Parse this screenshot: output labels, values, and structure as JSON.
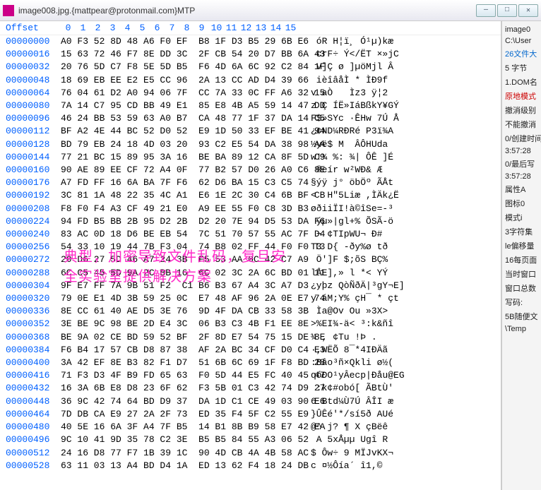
{
  "title": "image008.jpg.{mattpear@protonmail.com}MTP",
  "winbtns": {
    "min": "—",
    "max": "□",
    "close": "✕"
  },
  "header": {
    "offset": "Offset",
    "cols": [
      "0",
      "1",
      "2",
      "3",
      "4",
      "5",
      "6",
      "7",
      "8",
      "9",
      "10",
      "11",
      "12",
      "13",
      "14",
      "15"
    ]
  },
  "rows": [
    {
      "o": "00000000",
      "h": "A0 F3 52 8D 48 A6 F0 EF  B8 1F D3 B5 29 6B E6",
      "a": " óR H¦ï¸ Ó¹µ)kæ"
    },
    {
      "o": "00000016",
      "h": "15 63 72 46 F7 8E DD 3C  2F CB 54 20 D7 BB 6A 43",
      "a": " crF÷ Ý</ËT ×»jC"
    },
    {
      "o": "00000032",
      "h": "20 76 5D C7 F8 5E 5D B5  F6 4D 6A 6C 92 C2 84 1F",
      "a": " v]Ç ø ]µöMjl Â "
    },
    {
      "o": "00000048",
      "h": "18 69 EB EE E2 E5 CC 96  2A 13 CC AD D4 39 66",
      "a": " ièîâåÌ * ÌÐ9f"
    },
    {
      "o": "00000064",
      "h": "76 04 61 D2 A0 94 06 7F  CC 7A 33 0C FF A6 32 15",
      "a": "v aÒ   Ìz3 ÿ¦2 "
    },
    {
      "o": "00000080",
      "h": "7A 14 C7 95 CD BB 49 E1  85 E8 4B A5 59 14 47 DD",
      "a": "z Ç ÍË»IáBßkY¥GÝ"
    },
    {
      "o": "00000096",
      "h": "46 24 BB 53 59 63 A0 B7  CA 48 77 1F 37 DA 14 C5",
      "a": "F$»SYc ·ÊHw 7Ú Å"
    },
    {
      "o": "00000112",
      "h": "BF A2 4E 44 BC 52 D0 52  E9 1D 50 33 EF BE 41 94",
      "a": "¿¢ND¼RÐRé P3ï¾A "
    },
    {
      "o": "00000128",
      "h": "BD 79 EB 24 18 4D 03 20  93 C2 E5 54 DA 38 98 AA",
      "a": "½yë$ M  ÂÔHUda "
    },
    {
      "o": "00000144",
      "h": "77 21 BC 15 89 95 3A 16  BE BA 89 12 CA 8F 5D C9",
      "a": "w!¼ %: ¾| ÔÊ ]É"
    },
    {
      "o": "00000160",
      "h": "90 AE 89 EE CF 72 A4 0F  77 B2 57 D0 26 A0 C6 8E",
      "a": " ®eír w²WÐ& Æ "
    },
    {
      "o": "00000176",
      "h": "A7 FD FF 16 6A BA 7F F6  62 D6 BA 15 C3 C5 74",
      "a": "§ýÿ j° öbÖº ÃÅt"
    },
    {
      "o": "00000192",
      "h": "3C 81 1A 48 22 35 4C A1  E6 1E 2C 30 C4 6B BF CB",
      "a": "<  H\"5Liæ ,ÌÄk¿Ë"
    },
    {
      "o": "00000208",
      "h": "F8 F0 F4 A3 CF 49 21 E0  A9 EE 55 F0 C8 3D B3",
      "a": "øðiiÏI!à©îSe=-³"
    },
    {
      "o": "00000224",
      "h": "94 FD B5 BB 2B 95 D2 2B  D2 20 7E 94 D5 53 DA F6",
      "a": " ýµ»|gl+% ÕSÃ-ö"
    },
    {
      "o": "00000240",
      "h": "83 AC 0D 18 D6 BE EB 54  7C 51 70 57 55 AC 7F D4",
      "a": " ¬ ¢TIpWU¬ Ð#"
    },
    {
      "o": "00000256",
      "h": "54 33 10 19 44 7B F3 04  74 B8 02 FF 44 F0 F0 T3",
      "a": "T3 D{ -ðy%ø tð"
    },
    {
      "o": "00000272",
      "h": "20 D6 27 5D 46 A7 24 3B  F5 53 AA 0C 42 C7 A9",
      "a": " Ö']F $;õS BÇ%"
    },
    {
      "o": "00000288",
      "h": "6C C5 45 5D 9A 2C BB 16  6C 02 3C 2A 6C BD 01 11",
      "a": "lÅE],» l *< YÝ"
    },
    {
      "o": "00000304",
      "h": "9F E7 FF 7A 9B 51 F2  C1 B6 B3 67 A4 3C A7 D3",
      "a": "¿yþz QòÑðÄ|³gY¬E]"
    },
    {
      "o": "00000320",
      "h": "79 0E E1 4D 3B 59 25 0C  E7 48 AF 96 2A 0E E7 74",
      "a": "y áM;Y% çH¯ * çt"
    },
    {
      "o": "00000336",
      "h": "8E CC 61 40 AE D5 3E 76  9D 4F DA CB 33 58 3B",
      "a": " Ìa@Ov Ou »3X>"
    },
    {
      "o": "00000352",
      "h": "3E BE 9C 98 BE 2D E4 3C  06 B3 C3 4B F1 EE 8E",
      "a": ">%EI¾-ä< ³:k&ñî "
    },
    {
      "o": "00000368",
      "h": "BE 9A 02 CE BD 59 52 BF  2F 8D E7 54 75 15 DE 8E",
      "a": "¾ , ¢Tu !Þ ."
    },
    {
      "o": "00000384",
      "h": "F6 B4 17 57 CB D8 87 38  AF 2A BC 34 CF D0 C4 E3",
      "a": "·,WËÕ 8¯*4IÐÄã"
    },
    {
      "o": "00000400",
      "h": "3A 42 EF 8E B3 82 F1 D7  51 6B 6C 69 1F F8 BD 28",
      "a": ":Bâo³ñ×Qkli ø½("
    },
    {
      "o": "00000416",
      "h": "71 F3 D3 4F B9 FD 65 63  F0 5D 44 E5 FC 40 45 47",
      "a": "qóÐO¹yÂecp|Ðåu@EG"
    },
    {
      "o": "00000432",
      "h": "16 3A 6B E8 D8 23 6F 62  F3 5B 01 C3 42 74 D9 27",
      "a": " :k¢#obó[ ÃBtÙ'"
    },
    {
      "o": "00000448",
      "h": "36 9C 42 74 64 BD D9 37  DA 1D C1 CE 49 03 90 E6",
      "a": "6 Btd¼Ù7Ú ÂÎI æ"
    },
    {
      "o": "00000464",
      "h": "7D DB CA E9 27 2A 2F 73  ED 35 F4 5F C2 55 E9",
      "a": "}ÛÊé'*/sí5ð AUé"
    },
    {
      "o": "00000480",
      "h": "40 5E 16 6A 3F A4 7F B5  14 B1 8B B9 58 E7 42 EA",
      "a": "@^ j? ¶ X çBëê"
    },
    {
      "o": "00000496",
      "h": "9C 10 41 9D 35 78 C2 3E  B5 B5 84 55 A3 06 52",
      "a": " A 5xÅµµ Ugî R"
    },
    {
      "o": "00000512",
      "h": "24 16 D8 77 F7 1B 39 1C  90 4D CB 4A 4B 58 AC",
      "a": "$ Ôw÷ 9 MÏJvKX¬"
    },
    {
      "o": "00000528",
      "h": "63 11 03 13 A4 BD D4 1A  ED 13 62 F4 18 24 DB",
      "a": "c ¤½Ôía´ î1,©"
    }
  ],
  "side": [
    {
      "t": "image0",
      "c": ""
    },
    {
      "t": "C:\\User",
      "c": ""
    },
    {
      "t": "26文件大",
      "c": "side-blue"
    },
    {
      "t": "5 字节",
      "c": ""
    },
    {
      "t": "1.DOM名",
      "c": ""
    },
    {
      "t": "原地模式",
      "c": "side-red"
    },
    {
      "t": "撤消级别",
      "c": ""
    },
    {
      "t": "不能撤消",
      "c": ""
    },
    {
      "t": "0/创建时间",
      "c": ""
    },
    {
      "t": "3:57:28",
      "c": ""
    },
    {
      "t": "0/最后写",
      "c": ""
    },
    {
      "t": "3:57:28",
      "c": ""
    },
    {
      "t": "属性A",
      "c": ""
    },
    {
      "t": "图标0",
      "c": ""
    },
    {
      "t": "模式i",
      "c": ""
    },
    {
      "t": "3字符集",
      "c": ""
    },
    {
      "t": "le偏移量",
      "c": ""
    },
    {
      "t": "16每页面",
      "c": ""
    },
    {
      "t": "当时窗口",
      "c": ""
    },
    {
      "t": "窗口总数",
      "c": ""
    },
    {
      "t": "写码:",
      "c": ""
    },
    {
      "t": "5B随便文",
      "c": ""
    },
    {
      "t": "\\Temp",
      "c": ""
    }
  ],
  "watermark": {
    "line1": "典型，加密导致文件乱码，复旦安",
    "line2": "全实验室提供解决方案"
  }
}
